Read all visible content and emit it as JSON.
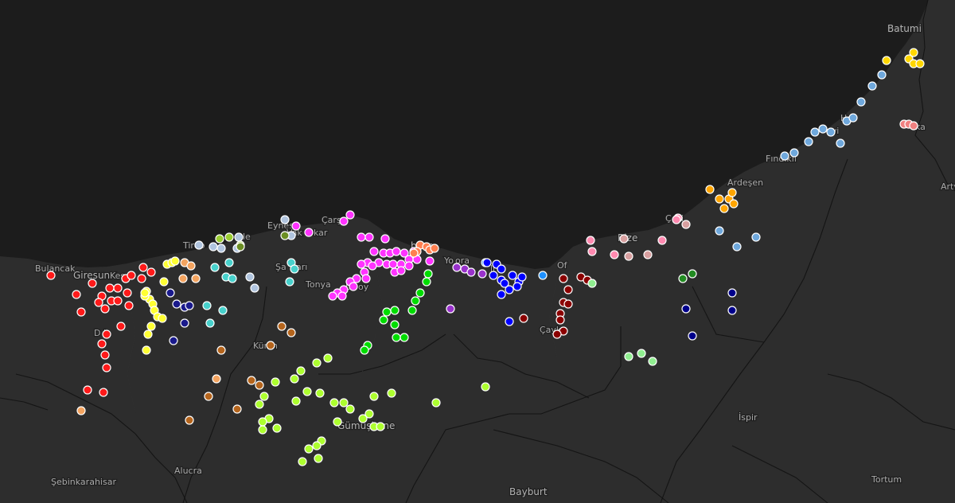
{
  "map": {
    "theme": "dark",
    "colors": {
      "sea": "#1c1c1c",
      "land": "#2d2d2d",
      "border": "#141414",
      "label": "#a9a9a9"
    },
    "place_labels": [
      {
        "name": "Batumi",
        "major": true
      },
      {
        "name": "Bulancak"
      },
      {
        "name": "Giresun",
        "major": true
      },
      {
        "name": "Kes"
      },
      {
        "name": "Tireb"
      },
      {
        "name": "le"
      },
      {
        "name": "Eynes"
      },
      {
        "name": "Vak"
      },
      {
        "name": "kar"
      },
      {
        "name": "Çarşı"
      },
      {
        "name": "Şa"
      },
      {
        "name": "arı"
      },
      {
        "name": "Tonya"
      },
      {
        "name": "bzon",
        "major": true
      },
      {
        "name": "Yo"
      },
      {
        "name": "ora"
      },
      {
        "name": "li"
      },
      {
        "name": "Of"
      },
      {
        "name": "Rize",
        "major": true
      },
      {
        "name": "Ç"
      },
      {
        "name": "eli"
      },
      {
        "name": "Ardeşen"
      },
      {
        "name": "Fındıkli"
      },
      {
        "name": "Ho"
      },
      {
        "name": "avi"
      },
      {
        "name": "ka"
      },
      {
        "name": "Artv"
      },
      {
        "name": "D"
      },
      {
        "name": "i"
      },
      {
        "name": "Kür"
      },
      {
        "name": "n"
      },
      {
        "name": "Gümüşhane",
        "major": true
      },
      {
        "name": "Alucra"
      },
      {
        "name": "Şebinkarahisar"
      },
      {
        "name": "Bayburt",
        "major": true
      },
      {
        "name": "İspir"
      },
      {
        "name": "Tortum"
      },
      {
        "name": "Çayk"
      },
      {
        "name": "ba"
      },
      {
        "name": "oy"
      }
    ],
    "marker_groups": [
      {
        "color": "#ff1a1a",
        "name": "red"
      },
      {
        "color": "#ffff33",
        "name": "yellow"
      },
      {
        "color": "#1a1a8c",
        "name": "navy"
      },
      {
        "color": "#f4a460",
        "name": "sandy"
      },
      {
        "color": "#48d1cc",
        "name": "turquoise"
      },
      {
        "color": "#b0c4de",
        "name": "steel"
      },
      {
        "color": "#9acd32",
        "name": "yellowgreen"
      },
      {
        "color": "#6b8e23",
        "name": "olive"
      },
      {
        "color": "#ff33ff",
        "name": "magenta"
      },
      {
        "color": "#ff7f50",
        "name": "coral"
      },
      {
        "color": "#1e90ff",
        "name": "blue"
      },
      {
        "color": "#0000ff",
        "name": "pureblue"
      },
      {
        "color": "#9932cc",
        "name": "purple"
      },
      {
        "color": "#00dd00",
        "name": "green"
      },
      {
        "color": "#adff2f",
        "name": "greenyellow"
      },
      {
        "color": "#b5651d",
        "name": "brown"
      },
      {
        "color": "#8b0000",
        "name": "darkred"
      },
      {
        "color": "#90ee90",
        "name": "lightgreen"
      },
      {
        "color": "#ff8ab0",
        "name": "pink"
      },
      {
        "color": "#d8a0a0",
        "name": "rosybrown"
      },
      {
        "color": "#228b22",
        "name": "forest"
      },
      {
        "color": "#ffa500",
        "name": "orange"
      },
      {
        "color": "#6fa8dc",
        "name": "skyblue"
      },
      {
        "color": "#00008b",
        "name": "darkblue"
      },
      {
        "color": "#ffd700",
        "name": "gold"
      },
      {
        "color": "#f08080",
        "name": "salmon"
      }
    ]
  }
}
